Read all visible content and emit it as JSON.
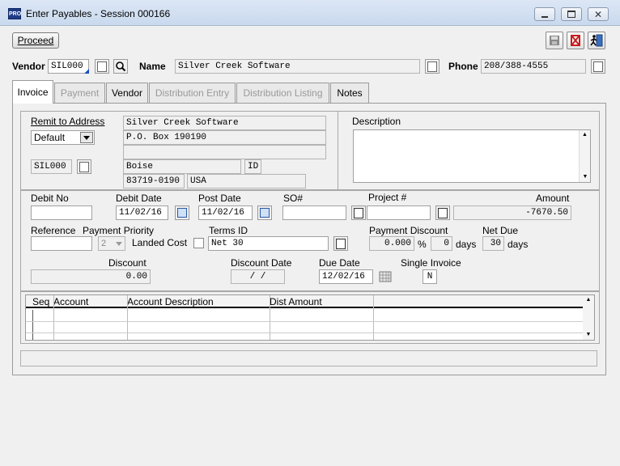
{
  "window": {
    "title": "Enter Payables - Session 000166",
    "app_badge": "PRO"
  },
  "toolbar": {
    "proceed_label": "Proceed"
  },
  "header": {
    "vendor_label": "Vendor",
    "vendor_value": "SIL000",
    "name_label": "Name",
    "name_value": "Silver Creek Software",
    "phone_label": "Phone",
    "phone_value": "208/388-4555"
  },
  "tabs": [
    {
      "label": "Invoice"
    },
    {
      "label": "Payment"
    },
    {
      "label": "Vendor"
    },
    {
      "label": "Distribution Entry"
    },
    {
      "label": "Distribution Listing"
    },
    {
      "label": "Notes"
    }
  ],
  "remit": {
    "label": "Remit to Address",
    "select_value": "Default",
    "code": "SIL000",
    "line1": "Silver Creek Software",
    "line2": "P.O. Box 190190",
    "line3": "",
    "city": "Boise",
    "state": "ID",
    "zip": "83719-0190",
    "country": "USA"
  },
  "description": {
    "label": "Description",
    "value": ""
  },
  "invoice": {
    "debit_no_label": "Debit No",
    "debit_no": "",
    "debit_date_label": "Debit Date",
    "debit_date": "11/02/16",
    "post_date_label": "Post Date",
    "post_date": "11/02/16",
    "so_label": "SO#",
    "so": "",
    "project_label": "Project #",
    "project": "",
    "amount_label": "Amount",
    "amount": "-7670.50",
    "reference_label": "Reference",
    "reference": "",
    "payment_priority_label": "Payment Priority",
    "payment_priority": "2",
    "landed_cost_label": "Landed Cost",
    "terms_id_label": "Terms ID",
    "terms_id": "Net 30",
    "payment_discount_label": "Payment Discount",
    "payment_discount": "0.000",
    "percent_sign": "%",
    "discount_days": "0",
    "days_label": "days",
    "net_due_label": "Net Due",
    "net_due_days": "30",
    "discount_label": "Discount",
    "discount": "0.00",
    "discount_date_label": "Discount Date",
    "discount_date": "/ /",
    "due_date_label": "Due Date",
    "due_date": "12/02/16",
    "single_invoice_label": "Single Invoice",
    "single_invoice": "N"
  },
  "grid": {
    "columns": [
      "Seq",
      "Account",
      "Account Description",
      "Dist Amount"
    ]
  }
}
